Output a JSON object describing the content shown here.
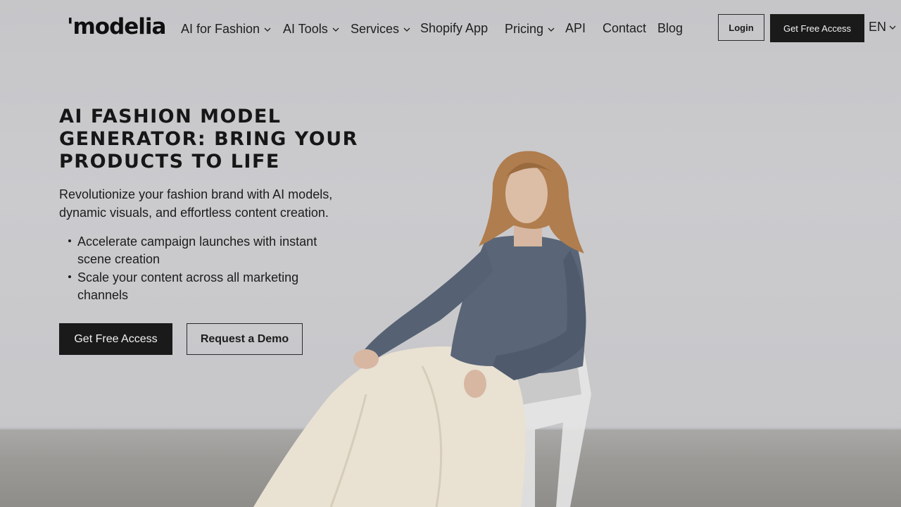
{
  "brand": {
    "logo_text": "'modelia"
  },
  "nav": {
    "items": [
      {
        "label": "AI for Fashion",
        "has_dropdown": true
      },
      {
        "label": "AI Tools",
        "has_dropdown": true
      },
      {
        "label": "Services",
        "has_dropdown": true
      },
      {
        "label": "Shopify App",
        "has_dropdown": false
      },
      {
        "label": "Pricing",
        "has_dropdown": true
      },
      {
        "label": "API",
        "has_dropdown": false
      },
      {
        "label": "Contact",
        "has_dropdown": false
      },
      {
        "label": "Blog",
        "has_dropdown": false
      }
    ],
    "login_label": "Login",
    "cta_label": "Get Free Access",
    "language": "EN"
  },
  "hero": {
    "title": "AI Fashion Model Generator: Bring Your Products to Life",
    "subtitle": "Revolutionize your fashion brand with AI models, dynamic visuals, and effortless content creation.",
    "bullets": [
      "Accelerate campaign launches with instant scene creation",
      "Scale your content across all marketing channels"
    ],
    "primary_cta": "Get Free Access",
    "secondary_cta": "Request a Demo"
  },
  "icons": {
    "dropdown": "chevron-down-icon"
  },
  "colors": {
    "dark": "#1a1a1a",
    "button_text": "#f2f2f2",
    "background": "#c9c9cb"
  }
}
